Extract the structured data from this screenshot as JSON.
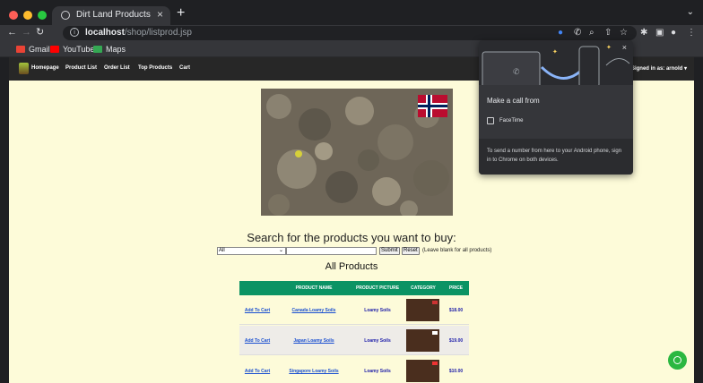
{
  "browser": {
    "tab_title": "Dirt Land Products",
    "new_tab": "+",
    "url_host": "localhost",
    "url_path": "/shop/listprod.jsp",
    "bookmarks": [
      "Gmail",
      "YouTube",
      "Maps"
    ]
  },
  "nav": {
    "links": [
      "Homepage",
      "Product List",
      "Order List",
      "Top Products",
      "Cart"
    ],
    "signed_in": "Signed in as: arnold ▾"
  },
  "search": {
    "title": "Search for the products you want to buy:",
    "select_value": "All",
    "input_value": "",
    "submit_label": "Submit",
    "reset_label": "Reset",
    "hint": "(Leave blank for all products)"
  },
  "products": {
    "heading": "All Products",
    "columns": [
      "",
      "PRODUCT NAME",
      "PRODUCT PICTURE",
      "CATEGORY",
      "PRICE"
    ],
    "rows": [
      {
        "action": "Add To Cart",
        "name": "Canada Loamy Soils",
        "category": "Loamy Soils",
        "price": "$18.00"
      },
      {
        "action": "Add To Cart",
        "name": "Japan Loamy Soils",
        "category": "Loamy Soils",
        "price": "$19.00"
      },
      {
        "action": "Add To Cart",
        "name": "Singapore Loamy Soils",
        "category": "Loamy Soils",
        "price": "$10.00"
      }
    ]
  },
  "popup": {
    "title": "Make a call from",
    "option": "FaceTime",
    "footer": "To send a number from here to your Android phone, sign in to Chrome on both devices."
  },
  "colors": {
    "page_bg": "#fdfbd9",
    "nav_bg": "#272727",
    "table_header": "#0b9364",
    "whatsapp": "#2bb741"
  }
}
